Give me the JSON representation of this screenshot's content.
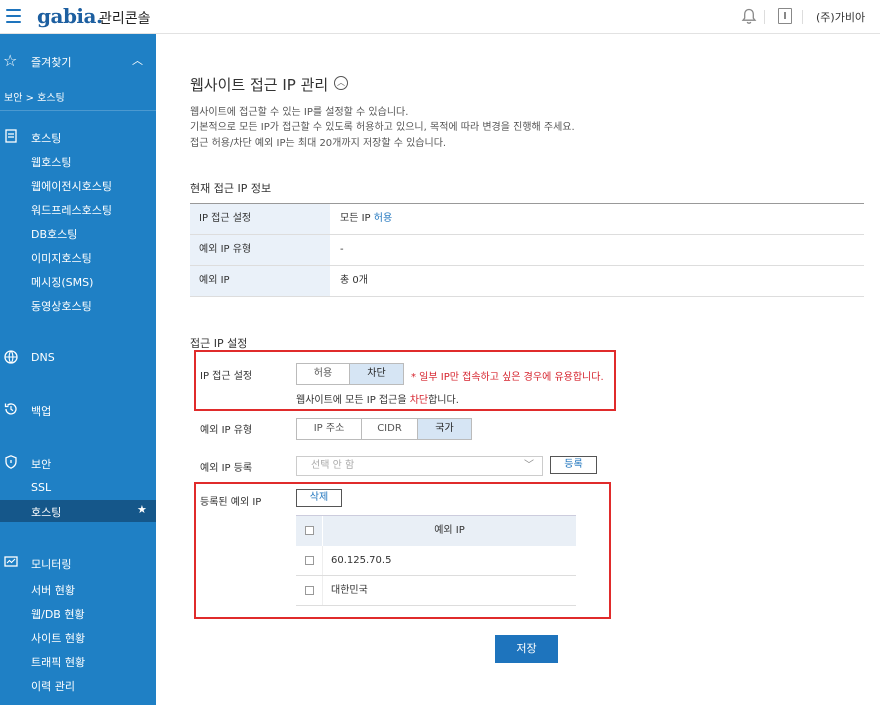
{
  "topbar": {
    "logo": "gabia.",
    "console_title": "관리콘솔",
    "company": "(주)가비아"
  },
  "sidebar": {
    "favorites_label": "즐겨찾기",
    "breadcrumb": "보안 > 호스팅",
    "sections": [
      {
        "label": "호스팅",
        "items": [
          "웹호스팅",
          "웹에이전시호스팅",
          "워드프레스호스팅",
          "DB호스팅",
          "이미지호스팅",
          "메시징(SMS)",
          "동영상호스팅"
        ]
      },
      {
        "label": "DNS",
        "items": []
      },
      {
        "label": "백업",
        "items": []
      },
      {
        "label": "보안",
        "items": [
          "SSL",
          "호스팅"
        ]
      },
      {
        "label": "모니터링",
        "items": [
          "서버 현황",
          "웹/DB 현황",
          "사이트 현황",
          "트래픽 현황",
          "이력 관리"
        ]
      }
    ],
    "active_item": "호스팅"
  },
  "page": {
    "title": "웹사이트 접근 IP 관리",
    "desc": [
      "웹사이트에 접근할 수 있는 IP를 설정할 수 있습니다.",
      "기본적으로 모든 IP가 접근할 수 있도록 허용하고 있으니, 목적에 따라 변경을 진행해 주세요.",
      "접근 허용/차단 예외 IP는 최대 20개까지 저장할 수 있습니다."
    ],
    "current_title": "현재 접근 IP 정보",
    "current": {
      "setting_label": "IP 접근 설정",
      "setting_value_prefix": "모든 IP ",
      "setting_value_hl": "허용",
      "type_label": "예외 IP 유형",
      "type_value": "-",
      "ip_label": "예외 IP",
      "ip_value": "총 0개"
    },
    "config_title": "접근 IP 설정",
    "config": {
      "access_label": "IP 접근 설정",
      "access_options": [
        "허용",
        "차단"
      ],
      "access_selected": "차단",
      "access_note": "* 일부 IP만 접속하고 싶은 경우에 유용합니다.",
      "access_desc_prefix": "웹사이트에 모든 IP 접근을 ",
      "access_desc_hl": "차단",
      "access_desc_suffix": "합니다.",
      "type_label": "예외 IP 유형",
      "type_options": [
        "IP 주소",
        "CIDR",
        "국가"
      ],
      "type_selected": "국가",
      "register_label": "예외 IP 등록",
      "register_placeholder": "선택 안 함",
      "register_button": "등록",
      "registered_label": "등록된 예외 IP",
      "delete_button": "삭제",
      "table_header": "예외 IP",
      "rows": [
        "60.125.70.5",
        "대한민국"
      ]
    },
    "save_button": "저장"
  }
}
